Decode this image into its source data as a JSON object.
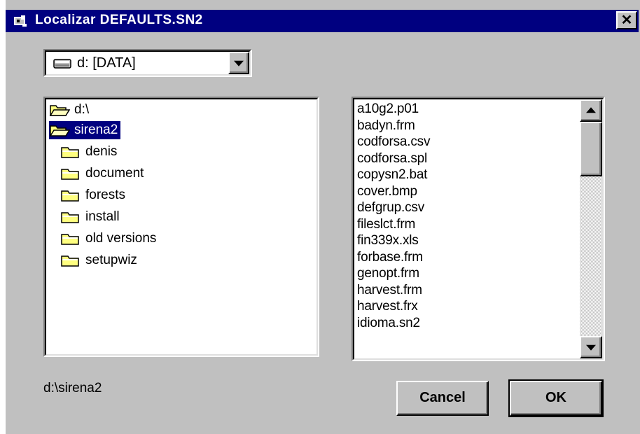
{
  "window": {
    "title": "Localizar DEFAULTS.SN2",
    "close_label": "✕"
  },
  "drive_combo": {
    "selected": "d: [DATA]",
    "icon": "hard-drive-icon"
  },
  "directory_tree": {
    "items": [
      {
        "label": "d:\\",
        "icon": "open-folder-icon",
        "selected": false
      },
      {
        "label": "sirena2",
        "icon": "open-folder-icon",
        "selected": true
      },
      {
        "label": "denis",
        "icon": "folder-icon",
        "selected": false
      },
      {
        "label": "document",
        "icon": "folder-icon",
        "selected": false
      },
      {
        "label": "forests",
        "icon": "folder-icon",
        "selected": false
      },
      {
        "label": "install",
        "icon": "folder-icon",
        "selected": false
      },
      {
        "label": "old versions",
        "icon": "folder-icon",
        "selected": false
      },
      {
        "label": "setupwiz",
        "icon": "folder-icon",
        "selected": false
      }
    ]
  },
  "file_list": {
    "items": [
      "a10g2.p01",
      "badyn.frm",
      "codforsa.csv",
      "codforsa.spl",
      "copysn2.bat",
      "cover.bmp",
      "defgrup.csv",
      "fileslct.frm",
      "fin339x.xls",
      "forbase.frm",
      "genopt.frm",
      "harvest.frm",
      "harvest.frx",
      "idioma.sn2"
    ]
  },
  "current_path": "d:\\sirena2",
  "buttons": {
    "cancel": "Cancel",
    "ok": "OK"
  },
  "colors": {
    "title_bar": "#000080",
    "selection": "#000080",
    "face": "#c0c0c0",
    "folder": "#ffff80"
  }
}
